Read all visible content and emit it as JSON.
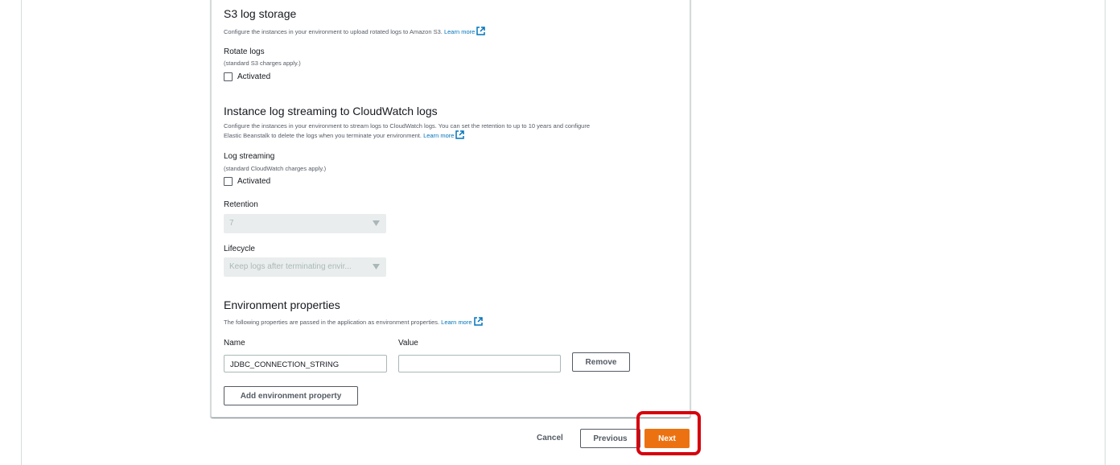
{
  "s3": {
    "title": "S3 log storage",
    "description": "Configure the instances in your environment to upload rotated logs to Amazon S3.",
    "learn_more": "Learn more",
    "rotate_label": "Rotate logs",
    "rotate_note": "(standard S3 charges apply.)",
    "rotate_checkbox": "Activated"
  },
  "cloudwatch": {
    "title": "Instance log streaming to CloudWatch logs",
    "description_line1": "Configure the instances in your environment to stream logs to CloudWatch logs. You can set the retention to up to 10 years and configure",
    "description_line2": "Elastic Beanstalk to delete the logs when you terminate your environment.",
    "learn_more": "Learn more",
    "streaming_label": "Log streaming",
    "streaming_note": "(standard CloudWatch charges apply.)",
    "streaming_checkbox": "Activated",
    "retention_label": "Retention",
    "retention_value": "7",
    "lifecycle_label": "Lifecycle",
    "lifecycle_value": "Keep logs after terminating envir..."
  },
  "env_props": {
    "title": "Environment properties",
    "description": "The following properties are passed in the application as environment properties.",
    "learn_more": "Learn more",
    "name_header": "Name",
    "value_header": "Value",
    "rows": [
      {
        "name": "JDBC_CONNECTION_STRING",
        "value": ""
      }
    ],
    "remove_label": "Remove",
    "add_label": "Add environment property"
  },
  "footer": {
    "cancel_label": "Cancel",
    "previous_label": "Previous",
    "next_label": "Next"
  },
  "colors": {
    "link": "#0073bb",
    "primary": "#ec7211",
    "highlight": "#d6000d"
  },
  "icons": {
    "external_link": "external-link-icon",
    "caret": "caret-down-icon"
  }
}
